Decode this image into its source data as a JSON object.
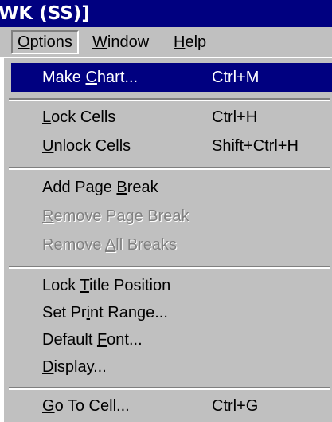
{
  "window": {
    "title": "WK (SS)]"
  },
  "menubar": {
    "options": {
      "pre": "",
      "mnemonic": "O",
      "post": "ptions"
    },
    "window": {
      "pre": "",
      "mnemonic": "W",
      "post": "indow"
    },
    "help": {
      "pre": "",
      "mnemonic": "H",
      "post": "elp"
    }
  },
  "menu": {
    "make_chart": {
      "pre": "Make ",
      "mnemonic": "C",
      "post": "hart...",
      "shortcut": "Ctrl+M"
    },
    "lock_cells": {
      "pre": "",
      "mnemonic": "L",
      "post": "ock Cells",
      "shortcut": "Ctrl+H"
    },
    "unlock_cells": {
      "pre": "",
      "mnemonic": "U",
      "post": "nlock Cells",
      "shortcut": "Shift+Ctrl+H"
    },
    "add_page_break": {
      "pre": "Add Page ",
      "mnemonic": "B",
      "post": "reak"
    },
    "remove_page_break": {
      "pre": "",
      "mnemonic": "R",
      "post": "emove Page Break"
    },
    "remove_all_breaks": {
      "pre": "Remove ",
      "mnemonic": "A",
      "post": "ll Breaks"
    },
    "lock_title_position": {
      "pre": "Lock ",
      "mnemonic": "T",
      "post": "itle Position"
    },
    "set_print_range": {
      "pre": "Set Pr",
      "mnemonic": "i",
      "post": "nt Range..."
    },
    "default_font": {
      "pre": "Default ",
      "mnemonic": "F",
      "post": "ont..."
    },
    "display": {
      "pre": "",
      "mnemonic": "D",
      "post": "isplay..."
    },
    "go_to_cell": {
      "pre": "",
      "mnemonic": "G",
      "post": "o To Cell...",
      "shortcut": "Ctrl+G"
    }
  },
  "colors": {
    "title_bar": "#000080",
    "menu_background": "#c0c0c0",
    "highlight": "#000080",
    "disabled_text": "#808080"
  }
}
